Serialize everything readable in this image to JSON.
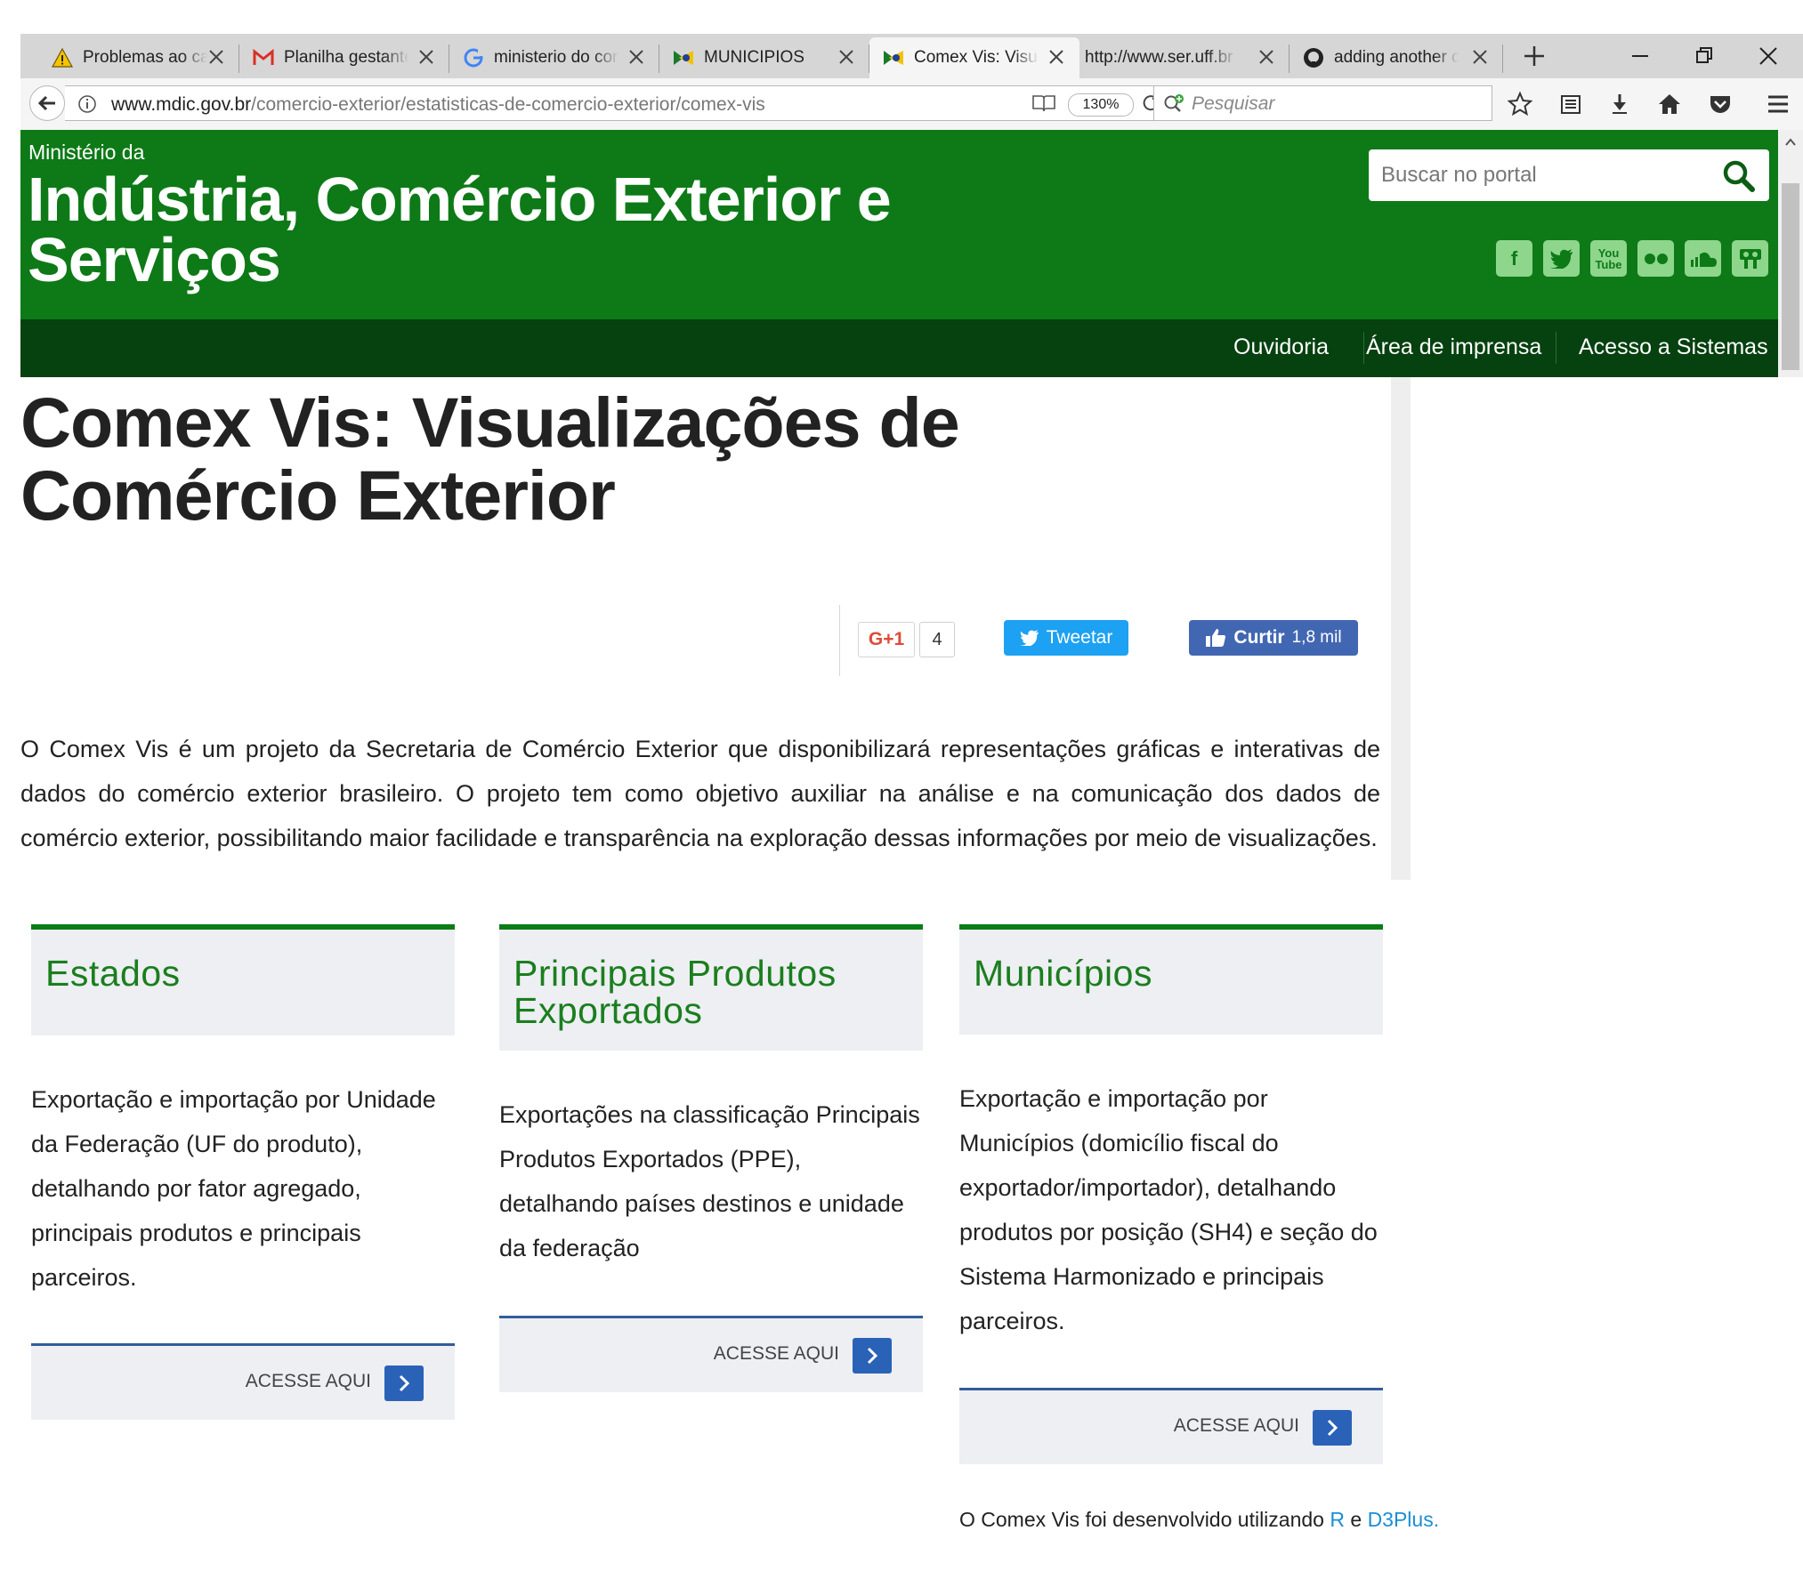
{
  "browser": {
    "tabs": [
      {
        "label": "Problemas ao carregar",
        "icon": "warning-icon"
      },
      {
        "label": "Planilha gestante",
        "icon": "gmail-icon"
      },
      {
        "label": "ministerio do comercio",
        "icon": "google-icon"
      },
      {
        "label": "MUNICIPIOS",
        "icon": "brazil-flag-icon"
      },
      {
        "label": "Comex Vis: Visualizações",
        "icon": "brazil-flag-icon",
        "active": true
      },
      {
        "label": "http://www.ser.uff.br",
        "icon": ""
      },
      {
        "label": "adding another column",
        "icon": "github-icon"
      }
    ],
    "url_domain": "www.mdic.gov.br",
    "url_path": "/comercio-exterior/estatisticas-de-comercio-exterior/comex-vis",
    "zoom": "130%",
    "search_placeholder": "Pesquisar"
  },
  "site": {
    "ministerio_label": "Ministério da",
    "title_line1": "Indústria, Comércio Exterior e",
    "title_line2": "Serviços",
    "search_placeholder": "Buscar no portal",
    "social": [
      "facebook-icon",
      "twitter-icon",
      "youtube-icon",
      "flickr-icon",
      "soundcloud-icon",
      "slideshare-icon"
    ],
    "menu": [
      "Ouvidoria",
      "Área de imprensa",
      "Acesso a Sistemas"
    ],
    "brand_color": "#0d7a17",
    "menu_color": "#064110"
  },
  "page": {
    "title": "Comex Vis: Visualizações de Comércio Exterior",
    "gplus_label": "G+1",
    "gplus_count": "4",
    "tweet_label": "Tweetar",
    "like_label": "Curtir",
    "like_count": "1,8 mil",
    "intro": "O Comex Vis é um projeto da Secretaria de Comércio Exterior que disponibilizará representações gráficas e interativas de dados do comércio exterior brasileiro. O projeto tem como objetivo auxiliar na análise e na comunicação dos dados de comércio exterior, possibilitando maior facilidade e transparência na exploração dessas informações por meio de visualizações.",
    "cards": [
      {
        "title": "Estados",
        "description": "Exportação e importação por Unidade da Federação (UF do produto), detalhando por fator agregado, principais produtos e principais parceiros.",
        "button": "ACESSE AQUI"
      },
      {
        "title": "Principais Produtos Exportados",
        "description": "Exportações na classificação Principais Produtos Exportados (PPE), detalhando países destinos e unidade da federação",
        "button": "ACESSE AQUI"
      },
      {
        "title": "Municípios",
        "description": "Exportação e importação por Municípios (domicílio fiscal do exportador/importador), detalhando produtos por posição (SH4) e seção do Sistema Harmonizado e principais parceiros.",
        "button": "ACESSE AQUI"
      }
    ],
    "footer_prefix": "O Comex Vis foi desenvolvido utilizando",
    "footer_link1": "R",
    "footer_conj": "e",
    "footer_link2": "D3Plus."
  }
}
